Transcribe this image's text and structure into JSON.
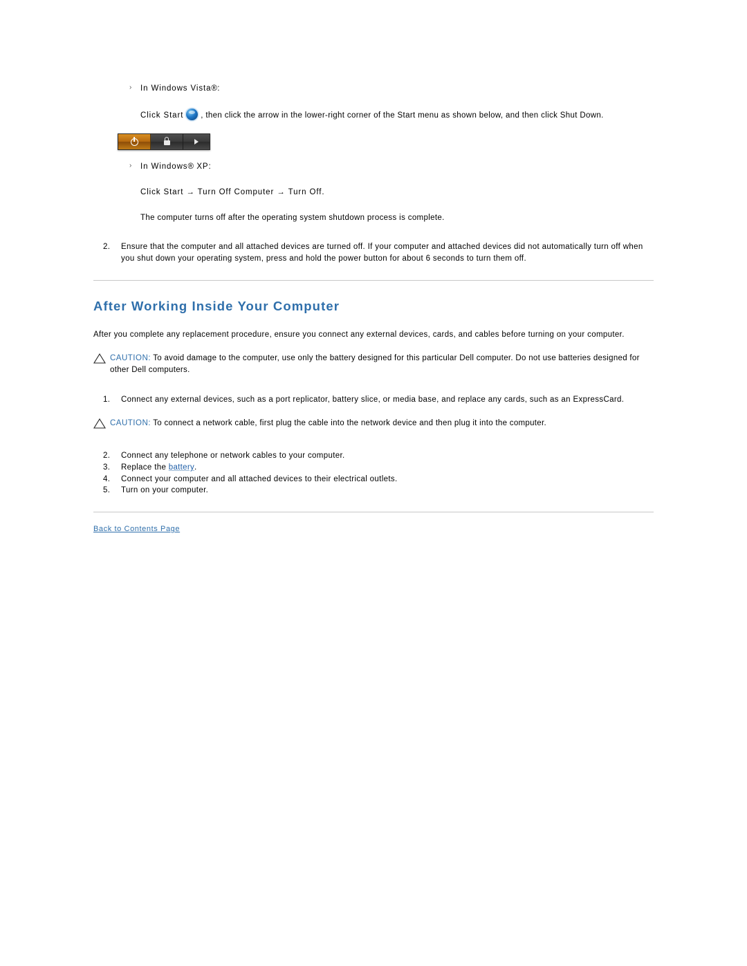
{
  "doc": {
    "steps_top": {
      "vista_bullet": "In Windows Vista",
      "vista_reg": "®",
      "vista_colon": ":",
      "vista_instruction_pre": "Click Start",
      "vista_instruction_post": ", then click the arrow in the lower-right corner of the Start menu as shown below, and then click Shut Down.",
      "xp_bullet_pre": "In Windows",
      "xp_reg": "®",
      "xp_bullet_post": " XP:",
      "xp_instruction": "Click Start → Turn Off Computer → Turn Off.",
      "shutdown_note": "The computer turns off after the operating system shutdown process is complete.",
      "item2_number": "2.",
      "item2_text": "Ensure that the computer and all attached devices are turned off. If your computer and attached devices did not automatically turn off when you shut down your operating system, press and hold the power button for about 6 seconds to turn them off."
    },
    "vista_bar": {
      "power_icon": "power-icon",
      "lock_icon": "lock-icon",
      "arrow_icon": "right-arrow-icon"
    },
    "section": {
      "title": "After Working Inside Your Computer",
      "intro": "After you complete any replacement procedure, ensure you connect any external devices, cards, and cables before turning on your computer.",
      "caution1_label": "CAUTION:",
      "caution1_text": " To avoid damage to the computer, use only the battery designed for this particular Dell computer. Do not use batteries designed for other Dell computers.",
      "step1_number": "1.",
      "step1_text": "Connect any external devices, such as a port replicator, battery slice, or media base, and replace any cards, such as an ExpressCard.",
      "caution2_label": "CAUTION:",
      "caution2_text": " To connect a network cable, first plug the cable into the network device and then plug it into the computer.",
      "steps": [
        {
          "number": "2.",
          "text": "Connect any telephone or network cables to your computer."
        },
        {
          "number": "3.",
          "text_pre": "Replace the ",
          "link": "battery",
          "text_post": "."
        },
        {
          "number": "4.",
          "text": "Connect your computer and all attached devices to their electrical outlets."
        },
        {
          "number": "5.",
          "text": "Turn on your computer."
        }
      ]
    },
    "footer": {
      "back_link": "Back to Contents Page"
    },
    "colors": {
      "heading_blue": "#2f6fab",
      "link_blue": "#1f5fa8",
      "rule_gray": "#c8c8c8"
    }
  }
}
